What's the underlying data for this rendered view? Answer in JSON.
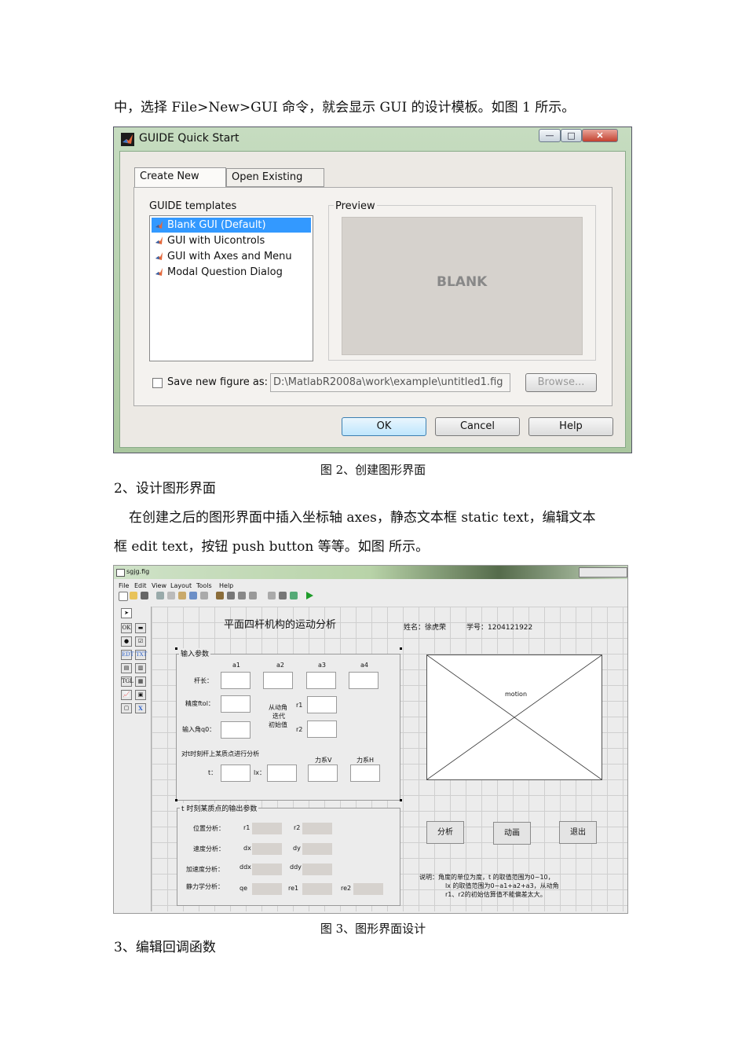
{
  "doc": {
    "intro_line": "中，选择 File>New>GUI 命令，就会显示 GUI 的设计模板。如图 1 所示。",
    "caption_fig2": "图 2、创建图形界面",
    "section2_heading": "2、设计图形界面",
    "para2_line1": "在创建之后的图形界面中插入坐标轴 axes，静态文本框 static text，编辑文本",
    "para2_line2": "框 edit text，按钮 push button 等等。如图  所示。",
    "caption_fig3": "图 3、图形界面设计",
    "section3_heading": "3、编辑回调函数"
  },
  "guide": {
    "window_title": "GUIDE Quick Start",
    "caption_buttons": {
      "minimize": "—",
      "maximize": "□",
      "close": "✕"
    },
    "tabs": [
      "Create New GUI",
      "Open Existing GUI"
    ],
    "templates_label": "GUIDE templates",
    "templates": [
      "Blank GUI (Default)",
      "GUI with Uicontrols",
      "GUI with Axes and Menu",
      "Modal Question Dialog"
    ],
    "selected_template_index": 0,
    "preview_label": "Preview",
    "preview_text": "BLANK",
    "save_label": "Save new figure as:",
    "save_checked": false,
    "save_path": "D:\\MatlabR2008a\\work\\example\\untitled1.fig",
    "browse_label": "Browse...",
    "ok_label": "OK",
    "cancel_label": "Cancel",
    "help_label": "Help"
  },
  "fig": {
    "window_title": "sgjg.fig",
    "menu": [
      "File",
      "Edit",
      "View",
      "Layout",
      "Tools",
      "Help"
    ],
    "heading": "平面四杆机构的运动分析",
    "name_label": "姓名：徐虎荣",
    "id_label": "学号：1204121922",
    "input_panel": {
      "title": "输入参数",
      "cols": [
        "a1",
        "a2",
        "a3",
        "a4"
      ],
      "rod_length": "杆长：",
      "precision": "精度ftol：",
      "input_angle": "输入角q0：",
      "iter_label_1": "从动角",
      "iter_label_2": "迭代",
      "iter_label_3": "初始值",
      "r1": "r1",
      "r2": "r2",
      "point_label": "对t时刻杆上某质点进行分析",
      "force_v": "力系V",
      "force_h": "力系H",
      "t_label": "t：",
      "lx_label": "lx："
    },
    "axes_label": "motion",
    "buttons": [
      "分析",
      "动画",
      "退出"
    ],
    "output_panel": {
      "title": "t 时刻某质点的输出参数",
      "rows": [
        {
          "label": "位置分析：",
          "a": "r1",
          "b": "r2"
        },
        {
          "label": "速度分析：",
          "a": "dx",
          "b": "dy"
        },
        {
          "label": "加速度分析：",
          "a": "ddx",
          "b": "ddy"
        },
        {
          "label": "静力学分析：",
          "a": "qe",
          "b": "re1",
          "c": "re2"
        }
      ]
    },
    "note_line1": "说明：角度的单位为度，t 的取值范围为0~10，",
    "note_line2": "lx 的取值范围为0~a1+a2+a3，从动角",
    "note_line3": "r1、r2的初始估算值不能偏差太大。"
  }
}
